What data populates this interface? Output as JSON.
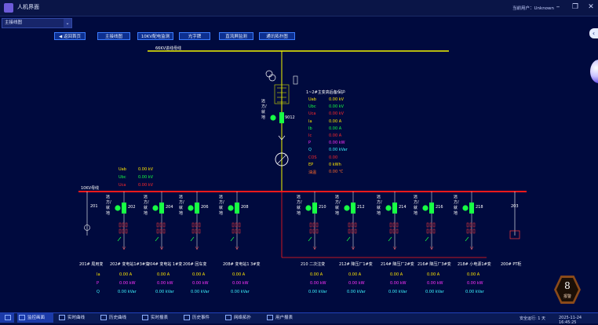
{
  "window": {
    "title": "人机界面",
    "user": "当前用户：Unknown",
    "minimize": "–",
    "restore": "❐",
    "close": "✕"
  },
  "view_select": "主接线图",
  "nav": {
    "home": "◀ 返回首页",
    "tabs": [
      "主接线图",
      "10KV配电监测",
      "光字牌",
      "直流屏监测",
      "通讯拓扑图"
    ]
  },
  "diagram": {
    "bus_66": "66KV进线母线",
    "bus_10": "10KV母线",
    "transformer_label": "1~2#主变高后备保护",
    "mode_text": "远方/就地",
    "main_breaker": "9012",
    "transformer_values": [
      {
        "name": "Uab",
        "value": "0.00 kV",
        "color": "y"
      },
      {
        "name": "Ubc",
        "value": "0.00 kV",
        "color": "g"
      },
      {
        "name": "Uca",
        "value": "0.00 kV",
        "color": "r"
      },
      {
        "name": "Ia",
        "value": "0.00 A",
        "color": "y"
      },
      {
        "name": "Ib",
        "value": "0.00 A",
        "color": "g"
      },
      {
        "name": "Ic",
        "value": "0.00 A",
        "color": "r"
      },
      {
        "name": "P",
        "value": "0.00 kW",
        "color": "m"
      },
      {
        "name": "Q",
        "value": "0.00 kVar",
        "color": "c"
      },
      {
        "name": "COS",
        "value": "0.00",
        "color": "r"
      },
      {
        "name": "EP",
        "value": "0 kWh",
        "color": "y"
      },
      {
        "name": "油温",
        "value": "0.00 ℃",
        "color": "o"
      }
    ],
    "bus_values": [
      {
        "name": "Uab",
        "value": "0.00 kV",
        "color": "y"
      },
      {
        "name": "Ubc",
        "value": "0.00 kV",
        "color": "g"
      },
      {
        "name": "Uca",
        "value": "0.00 kV",
        "color": "r"
      }
    ],
    "feeder_left_code": "201",
    "feeder_right_code": "203",
    "feeders": [
      {
        "code": "202",
        "name": "202# 变电站1#3#变",
        "ia": "0.00 A",
        "p": "0.00 kW",
        "q": "0.00 kVar"
      },
      {
        "code": "204",
        "name": "204# 变电站 1#变",
        "ia": "0.00 A",
        "p": "0.00 kW",
        "q": "0.00 kVar"
      },
      {
        "code": "206",
        "name": "206# 回车变",
        "ia": "0.00 A",
        "p": "0.00 kW",
        "q": "0.00 kVar"
      },
      {
        "code": "208",
        "name": "208# 变电站1 3#变",
        "ia": "0.00 A",
        "p": "0.00 kW",
        "q": "0.00 kVar"
      },
      {
        "code": "210",
        "name": "210 二次注变",
        "ia": "0.00 A",
        "p": "0.00 kW",
        "q": "0.00 kVar"
      },
      {
        "code": "212",
        "name": "212# 降压厂1#变",
        "ia": "0.00 A",
        "p": "0.00 kW",
        "q": "0.00 kVar"
      },
      {
        "code": "214",
        "name": "214# 降压厂2#变",
        "ia": "0.00 A",
        "p": "0.00 kW",
        "q": "0.00 kVar"
      },
      {
        "code": "216",
        "name": "216# 降压厂3#变",
        "ia": "0.00 A",
        "p": "0.00 kW",
        "q": "0.00 kVar"
      },
      {
        "code": "218",
        "name": "218# 小电源1#变",
        "ia": "0.00 A",
        "p": "0.00 kW",
        "q": "0.00 kVar"
      }
    ],
    "left_feeder_name": "201# 局用变",
    "right_feeder_name": "200# PT柜",
    "row_labels": [
      "Ia",
      "P",
      "Q"
    ]
  },
  "alarm": {
    "count": "8",
    "label": "报警"
  },
  "taskbar": {
    "tabs": [
      "监控画面",
      "实时曲线",
      "历史曲线",
      "实时报表",
      "历史事件",
      "网络拓扑",
      "用户报表"
    ],
    "run_label": "安全运行: 1 天",
    "datetime": "2025-11-24 16:45:25"
  }
}
